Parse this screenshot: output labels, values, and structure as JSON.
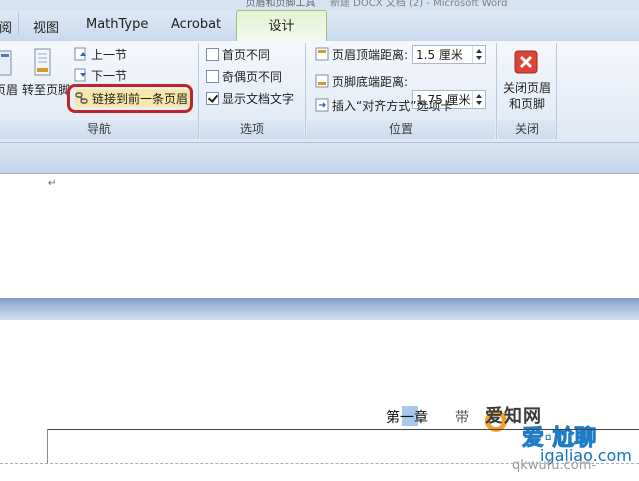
{
  "window": {
    "contextual_tab_title": "页眉和页脚工具",
    "title": "新建 DOCX 文档 (2) - Microsoft Word"
  },
  "tabs": [
    {
      "label": "审阅"
    },
    {
      "label": "视图"
    },
    {
      "label": "MathType"
    },
    {
      "label": "Acrobat"
    },
    {
      "label": "设计",
      "active": true
    }
  ],
  "ribbon": {
    "navigation": {
      "label": "导航",
      "goto_header_label": "页眉",
      "goto_footer_label": "转至页脚",
      "prev_section": "上一节",
      "next_section": "下一节",
      "link_previous": "链接到前一条页眉"
    },
    "options": {
      "label": "选项",
      "different_first_page": {
        "label": "首页不同",
        "checked": false
      },
      "different_odd_even": {
        "label": "奇偶页不同",
        "checked": false
      },
      "show_document_text": {
        "label": "显示文档文字",
        "checked": true
      }
    },
    "position": {
      "label": "位置",
      "header_from_top_label": "页眉顶端距离:",
      "header_from_top_value": "1.5 厘米",
      "footer_from_bottom_label": "页脚底端距离:",
      "footer_from_bottom_value": "1.75 厘米",
      "insert_alignment_tab": "插入“对齐方式”选项卡"
    },
    "close": {
      "label": "关闭",
      "close_button_line1": "关闭页眉",
      "close_button_line2": "和页脚"
    }
  },
  "document": {
    "header_chapter_text": "第一章",
    "watermark_glyph": "带",
    "watermark_logo": "爱知网",
    "watermark_brand": "爱·尬聊",
    "watermark_site": "igaliao.com",
    "watermark_site2": "qkwufu.com-"
  },
  "colors": {
    "highlight_box": "#c0242b",
    "active_tab": "#e4f3d2",
    "ribbon_bg": "#dfe8f4"
  }
}
